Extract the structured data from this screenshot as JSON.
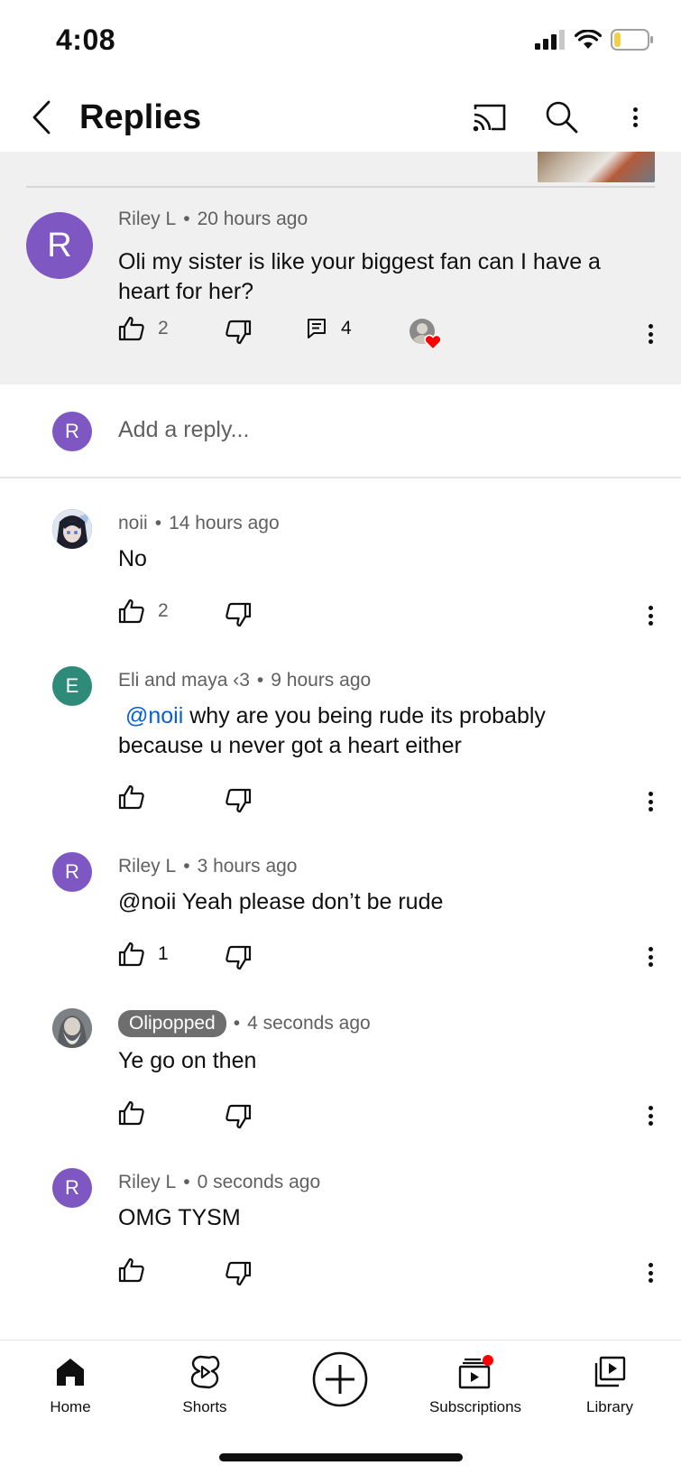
{
  "status_bar": {
    "time": "4:08"
  },
  "header": {
    "title": "Replies"
  },
  "parent_comment": {
    "avatar_letter": "R",
    "avatar_color": "#7e57c2",
    "author": "Riley L",
    "time": "20 hours ago",
    "text": "Oli my sister is like your biggest fan can I have a heart for her?",
    "likes": "2",
    "replies": "4"
  },
  "add_reply": {
    "avatar_letter": "R",
    "placeholder": "Add a reply..."
  },
  "replies": [
    {
      "author": "noii",
      "time": "14 hours ago",
      "text": "No",
      "likes": "2",
      "avatar_icon": "anime-avatar-icon"
    },
    {
      "author": "Eli and maya ‹3",
      "time": "9 hours ago",
      "mention": "@noii",
      "text": " why are you being rude its probably because u never got a heart either",
      "likes": "",
      "avatar_letter": "E",
      "avatar_color": "#2e8b7a"
    },
    {
      "author": "Riley L",
      "time": "3 hours ago",
      "text": "@noii Yeah please don’t be rude",
      "likes": "1",
      "avatar_letter": "R",
      "avatar_color": "#7e57c2"
    },
    {
      "author": "Olipopped",
      "time": "4 seconds ago",
      "text": "Ye go on then",
      "likes": "",
      "avatar_icon": "creator-avatar-icon",
      "is_creator": true
    },
    {
      "author": "Riley L",
      "time": "0 seconds ago",
      "text": "OMG TYSM",
      "likes": "",
      "avatar_letter": "R",
      "avatar_color": "#7e57c2"
    }
  ],
  "nav": {
    "home": "Home",
    "shorts": "Shorts",
    "subscriptions": "Subscriptions",
    "library": "Library"
  },
  "colors": {
    "accent_red": "#ff0000",
    "mention_blue": "#065fd4",
    "parent_bg": "#f0f0f0"
  }
}
